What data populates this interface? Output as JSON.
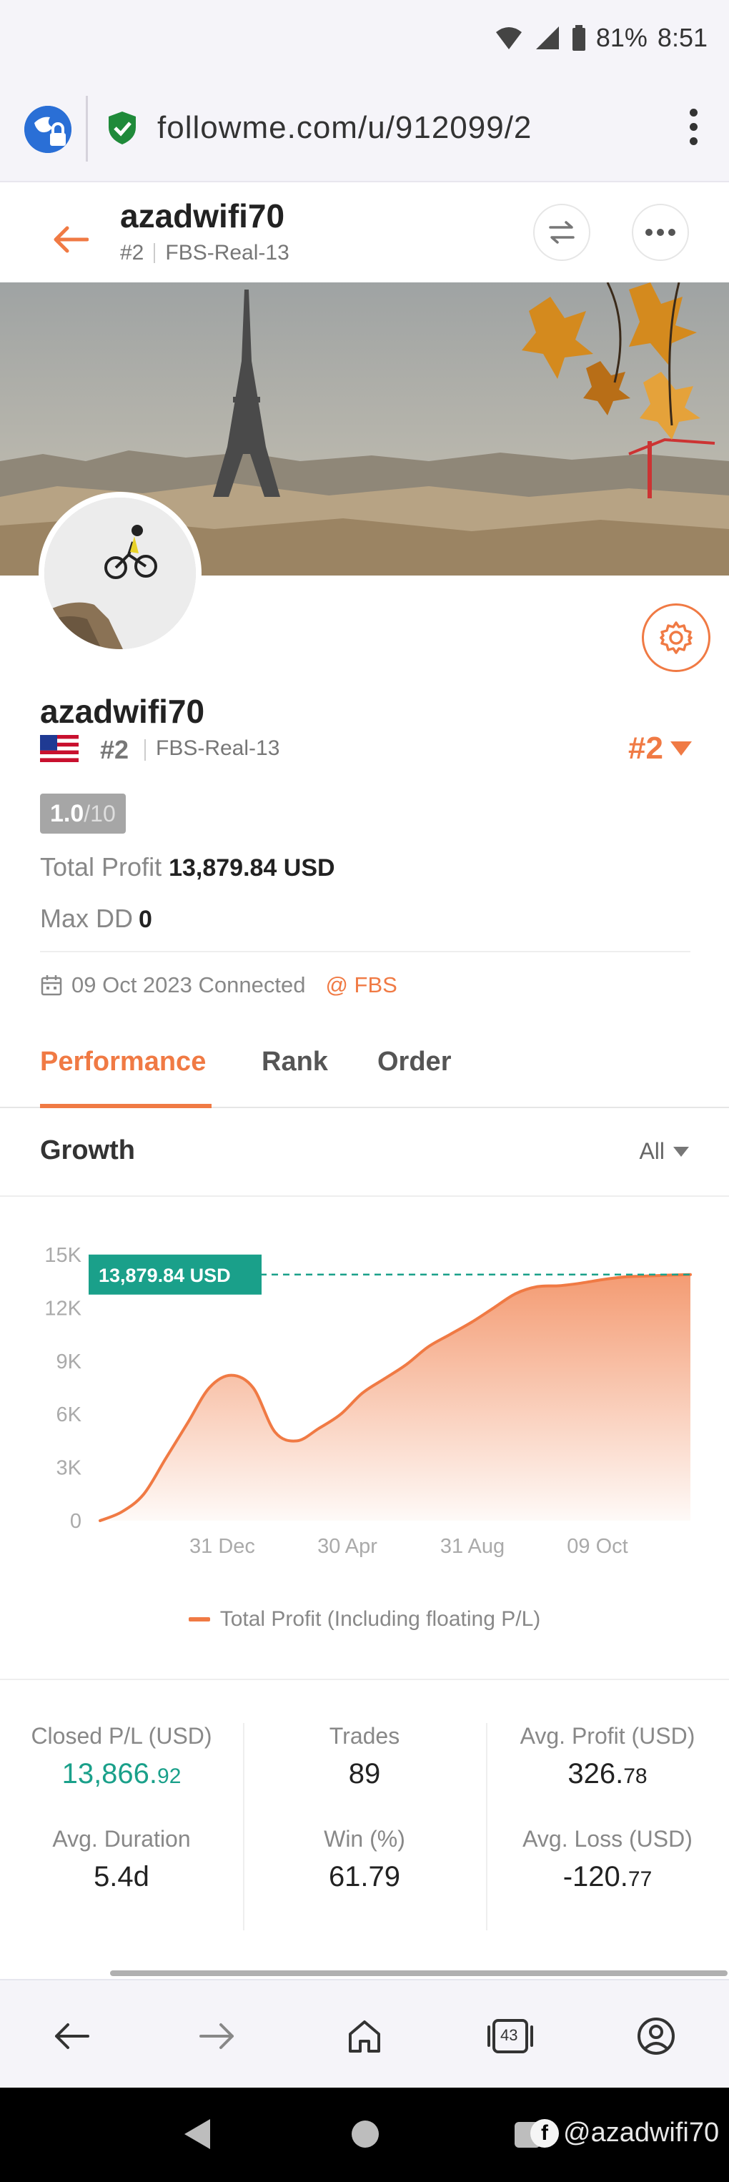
{
  "status_bar": {
    "battery": "81%",
    "time": "8:51"
  },
  "browser": {
    "url": "followme.com/u/912099/2"
  },
  "header": {
    "name": "azadwifi70",
    "rank": "#2",
    "account": "FBS-Real-13"
  },
  "profile": {
    "name": "azadwifi70",
    "rank": "#2",
    "account": "FBS-Real-13",
    "rank_badge": "#2",
    "score": "1.0",
    "score_max": "/10",
    "total_profit_label": "Total Profit",
    "total_profit_value": "13,879.84 USD",
    "maxdd_label": "Max DD",
    "maxdd_value": "0",
    "connected": "09 Oct 2023 Connected",
    "broker": "@ FBS"
  },
  "tabs": [
    {
      "label": "Performance"
    },
    {
      "label": "Rank"
    },
    {
      "label": "Order"
    }
  ],
  "growth": {
    "title": "Growth",
    "filter": "All"
  },
  "chart_data": {
    "type": "area",
    "y_ticks": [
      "0",
      "3K",
      "6K",
      "9K",
      "12K",
      "15K"
    ],
    "x_ticks": [
      "31 Dec",
      "30 Apr",
      "31 Aug",
      "09 Oct"
    ],
    "ylim": [
      0,
      15000
    ],
    "tooltip": "13,879.84 USD",
    "series": [
      {
        "name": "Total Profit (Including floating P/L)",
        "color": "#f07a44",
        "values": [
          0,
          500,
          1500,
          3500,
          5500,
          7500,
          8200,
          7500,
          5000,
          4500,
          5200,
          6000,
          7200,
          8000,
          8800,
          9800,
          10500,
          11200,
          12000,
          12800,
          13200,
          13250,
          13400,
          13600,
          13750,
          13800,
          13850,
          13879.84
        ]
      }
    ]
  },
  "stats": [
    {
      "label": "Closed P/L (USD)",
      "value_main": "13,866.",
      "value_small": "92"
    },
    {
      "label": "Trades",
      "value_main": "89",
      "value_small": ""
    },
    {
      "label": "Avg. Profit (USD)",
      "value_main": "326.",
      "value_small": "78"
    },
    {
      "label": "Avg. Duration",
      "value_main": "5.4d",
      "value_small": ""
    },
    {
      "label": "Win (%)",
      "value_main": "61.79",
      "value_small": ""
    },
    {
      "label": "Avg. Loss (USD)",
      "value_main": "-120.",
      "value_small": "77"
    }
  ],
  "browser_nav": {
    "tab_count": "43"
  },
  "watermark": {
    "text": "@azadwifi70"
  }
}
